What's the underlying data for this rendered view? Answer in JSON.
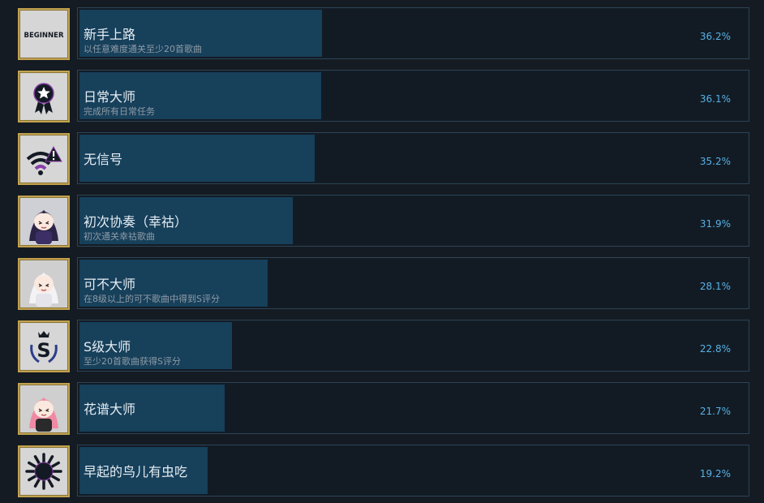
{
  "achievements": [
    {
      "name": "新手上路",
      "description": "以任意难度通关至少20首歌曲",
      "percent_label": "36.2%",
      "percent": 36.2,
      "icon": "beginner-badge-icon"
    },
    {
      "name": "日常大师",
      "description": "完成所有日常任务",
      "percent_label": "36.1%",
      "percent": 36.1,
      "icon": "star-ribbon-icon"
    },
    {
      "name": "无信号",
      "description": "",
      "percent_label": "35.2%",
      "percent": 35.2,
      "icon": "wifi-warning-icon"
    },
    {
      "name": "初次协奏（幸祜）",
      "description": "初次通关幸祜歌曲",
      "percent_label": "31.9%",
      "percent": 31.9,
      "icon": "character-portrait-icon"
    },
    {
      "name": "可不大师",
      "description": "在8级以上的可不歌曲中得到S评分",
      "percent_label": "28.1%",
      "percent": 28.1,
      "icon": "character-portrait-icon"
    },
    {
      "name": "S级大师",
      "description": "至少20首歌曲获得S评分",
      "percent_label": "22.8%",
      "percent": 22.8,
      "icon": "s-rank-crown-icon"
    },
    {
      "name": "花谱大师",
      "description": "",
      "percent_label": "21.7%",
      "percent": 21.7,
      "icon": "character-portrait-icon"
    },
    {
      "name": "早起的鸟儿有虫吃",
      "description": "",
      "percent_label": "19.2%",
      "percent": 19.2,
      "icon": "sun-icon"
    }
  ],
  "colors": {
    "background": "#151b22",
    "panel": "#121b24",
    "progress_fill": "#17405b",
    "percent_text": "#57b1e6",
    "icon_frame": "#c2a24e"
  },
  "icon_texts": {
    "beginner": "BEGINNER"
  }
}
